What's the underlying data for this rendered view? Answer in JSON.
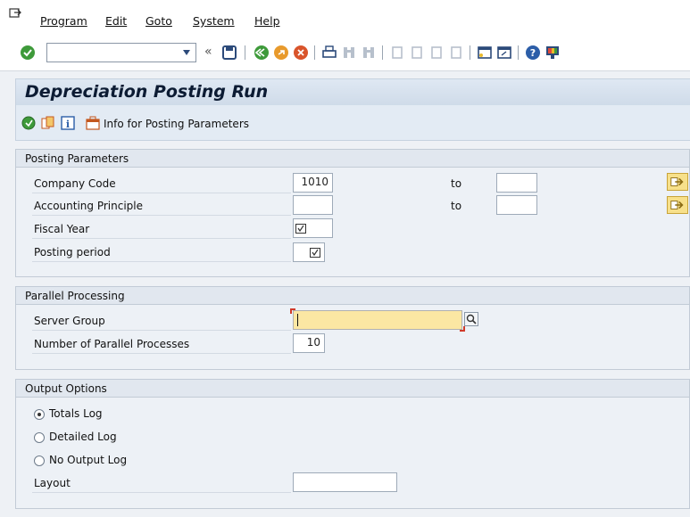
{
  "menu": {
    "items": [
      "Program",
      "Edit",
      "Goto",
      "System",
      "Help"
    ]
  },
  "toolbar": {
    "command_field_value": "",
    "icons": [
      "enter-icon",
      "save-icon",
      "back-icon",
      "exit-icon",
      "cancel-icon",
      "print-icon",
      "find-icon",
      "find-next-icon",
      "first-page-icon",
      "previous-page-icon",
      "next-page-icon",
      "last-page-icon",
      "create-session-icon",
      "shortcut-icon",
      "help-icon",
      "customize-layout-icon"
    ]
  },
  "title": "Depreciation Posting Run",
  "app_toolbar": {
    "info_label": "Info for Posting Parameters"
  },
  "posting_parameters": {
    "header": "Posting Parameters",
    "company_code_label": "Company Code",
    "company_code_value": "1010",
    "company_code_to_label": "to",
    "company_code_to_value": "",
    "accounting_principle_label": "Accounting Principle",
    "accounting_principle_value": "",
    "accounting_principle_to_label": "to",
    "accounting_principle_to_value": "",
    "fiscal_year_label": "Fiscal Year",
    "posting_period_label": "Posting period"
  },
  "parallel_processing": {
    "header": "Parallel Processing",
    "server_group_label": "Server Group",
    "server_group_value": "",
    "num_processes_label": "Number of Parallel Processes",
    "num_processes_value": "10"
  },
  "output_options": {
    "header": "Output Options",
    "options": [
      "Totals Log",
      "Detailed Log",
      "No Output Log"
    ],
    "selected": "Totals Log",
    "layout_label": "Layout",
    "layout_value": ""
  },
  "colors": {
    "title_bg": "#d4dfec",
    "required_field": "#fbe7a3",
    "multisel_button": "#f7e08a"
  }
}
